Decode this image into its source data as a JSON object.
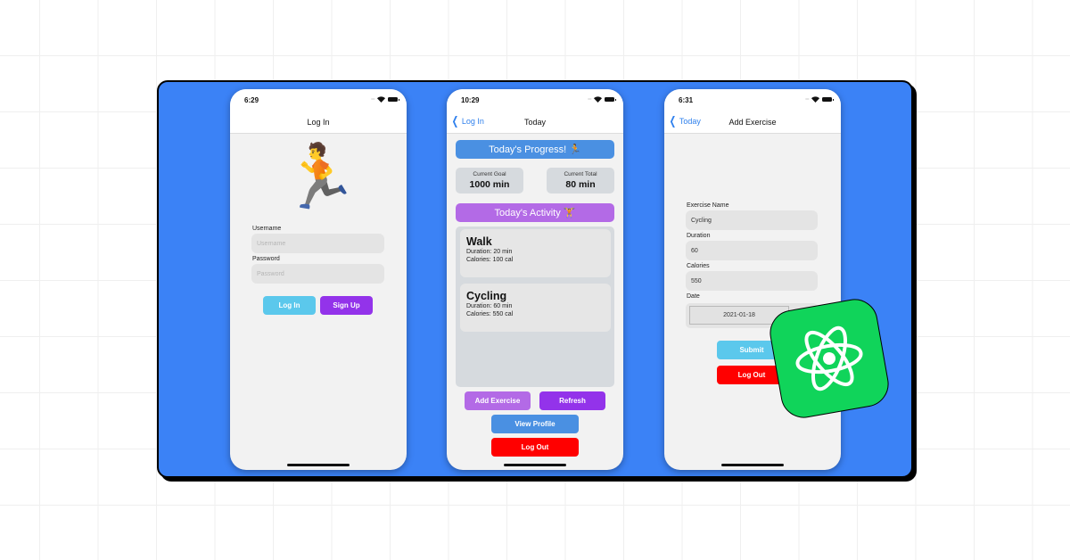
{
  "colors": {
    "panel": "#3b82f6",
    "login_button": "#5bc8ec",
    "signup_button": "#9333ea",
    "progress_banner": "#4a90e2",
    "activity_banner": "#b36ae6",
    "add_exercise_button": "#b36ae6",
    "refresh_button": "#9333ea",
    "view_profile_button": "#4a90e2",
    "logout_button": "#ff0000",
    "submit_button": "#5bc8ec",
    "react_badge": "#10d45a"
  },
  "login_screen": {
    "status_time": "6:29",
    "nav_title": "Log In",
    "hero_emoji": "🏃",
    "username_label": "Username",
    "username_placeholder": "Username",
    "password_label": "Password",
    "password_placeholder": "Password",
    "login_button": "Log In",
    "signup_button": "Sign Up"
  },
  "today_screen": {
    "status_time": "10:29",
    "back_label": "Log In",
    "nav_title": "Today",
    "progress_banner": "Today's Progress! 🏃",
    "current_goal_label": "Current Goal",
    "current_goal_value": "1000 min",
    "current_total_label": "Current Total",
    "current_total_value": "80 min",
    "activity_banner": "Today's Activity 🏋️",
    "activities": [
      {
        "name": "Walk",
        "duration": "Duration: 20 min",
        "calories": "Calories: 100 cal"
      },
      {
        "name": "Cycling",
        "duration": "Duration: 60 min",
        "calories": "Calories: 550 cal"
      }
    ],
    "add_exercise_button": "Add Exercise",
    "refresh_button": "Refresh",
    "view_profile_button": "View Profile",
    "logout_button": "Log Out"
  },
  "add_exercise_screen": {
    "status_time": "6:31",
    "back_label": "Today",
    "nav_title": "Add Exercise",
    "exercise_name_label": "Exercise Name",
    "exercise_name_value": "Cycling",
    "duration_label": "Duration",
    "duration_value": "60",
    "calories_label": "Calories",
    "calories_value": "550",
    "date_label": "Date",
    "date_value": "2021-01-18",
    "submit_button": "Submit",
    "logout_button": "Log Out"
  },
  "badge": {
    "icon": "react-atom-icon"
  }
}
